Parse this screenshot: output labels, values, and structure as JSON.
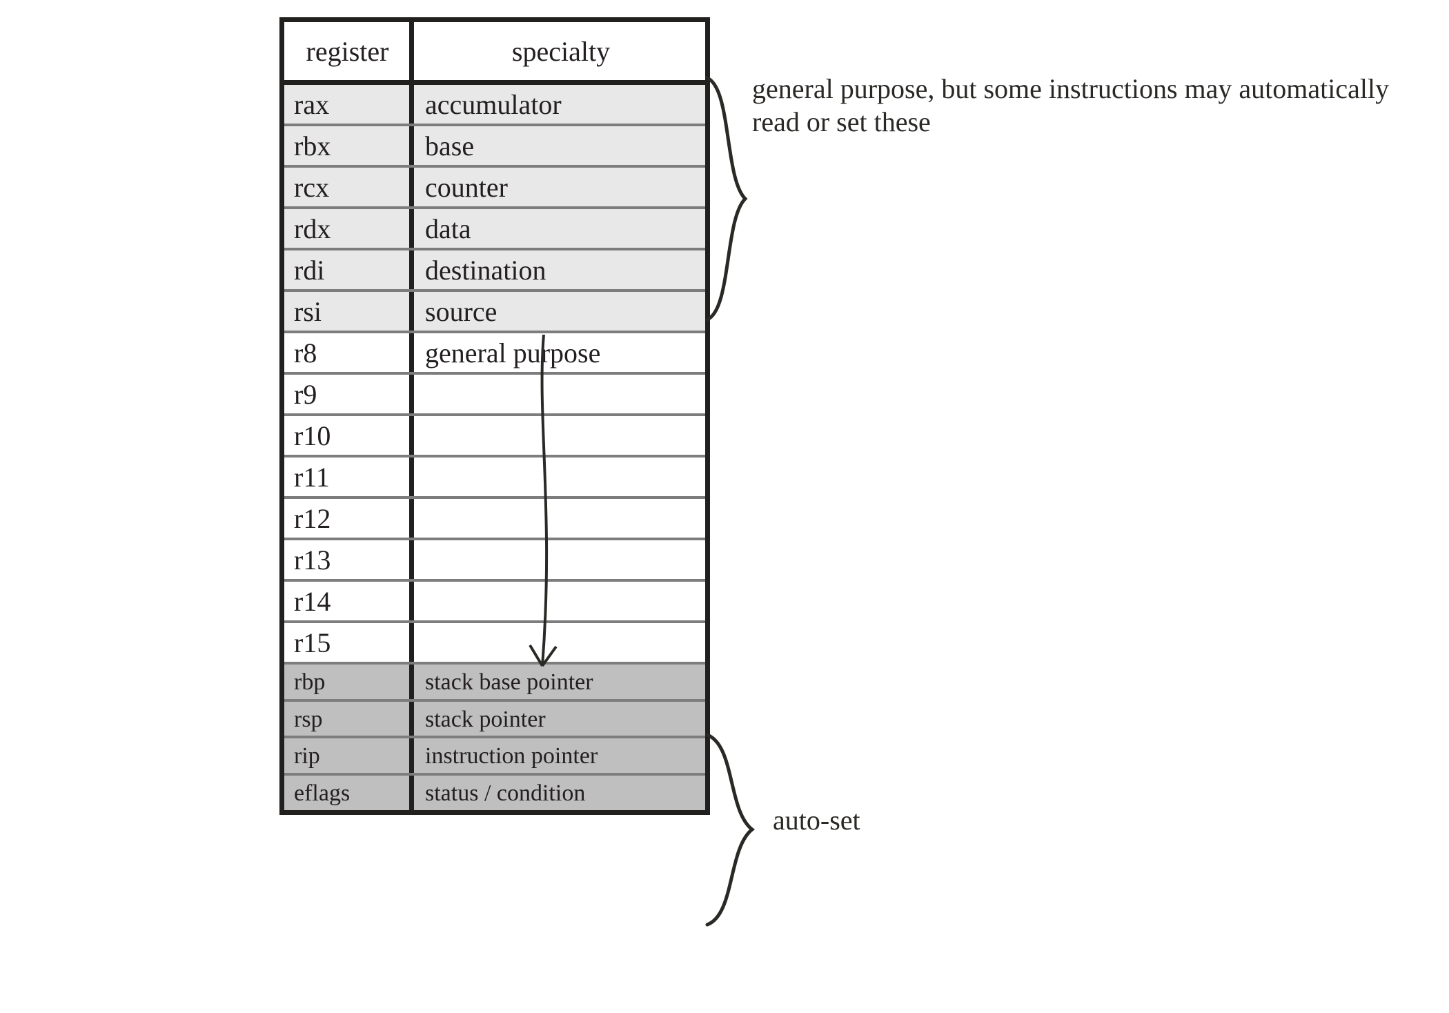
{
  "headers": {
    "register": "register",
    "specialty": "specialty"
  },
  "rows": [
    {
      "reg": "rax",
      "spec": "accumulator",
      "shade": "a"
    },
    {
      "reg": "rbx",
      "spec": "base",
      "shade": "a"
    },
    {
      "reg": "rcx",
      "spec": "counter",
      "shade": "a"
    },
    {
      "reg": "rdx",
      "spec": "data",
      "shade": "a"
    },
    {
      "reg": "rdi",
      "spec": "destination",
      "shade": "a"
    },
    {
      "reg": "rsi",
      "spec": "source",
      "shade": "a"
    },
    {
      "reg": "r8",
      "spec": "general purpose",
      "shade": ""
    },
    {
      "reg": "r9",
      "spec": "",
      "shade": ""
    },
    {
      "reg": "r10",
      "spec": "",
      "shade": ""
    },
    {
      "reg": "r11",
      "spec": "",
      "shade": ""
    },
    {
      "reg": "r12",
      "spec": "",
      "shade": ""
    },
    {
      "reg": "r13",
      "spec": "",
      "shade": ""
    },
    {
      "reg": "r14",
      "spec": "",
      "shade": ""
    },
    {
      "reg": "r15",
      "spec": "",
      "shade": ""
    },
    {
      "reg": "rbp",
      "spec": "stack base pointer",
      "shade": "b",
      "small": true
    },
    {
      "reg": "rsp",
      "spec": "stack pointer",
      "shade": "b",
      "small": true
    },
    {
      "reg": "rip",
      "spec": "instruction pointer",
      "shade": "b",
      "small": true
    },
    {
      "reg": "eflags",
      "spec": "status / condition",
      "shade": "b",
      "small": true
    }
  ],
  "notes": {
    "general": "general purpose, but some instructions may automatically read or set these",
    "autoset": "auto-set"
  }
}
